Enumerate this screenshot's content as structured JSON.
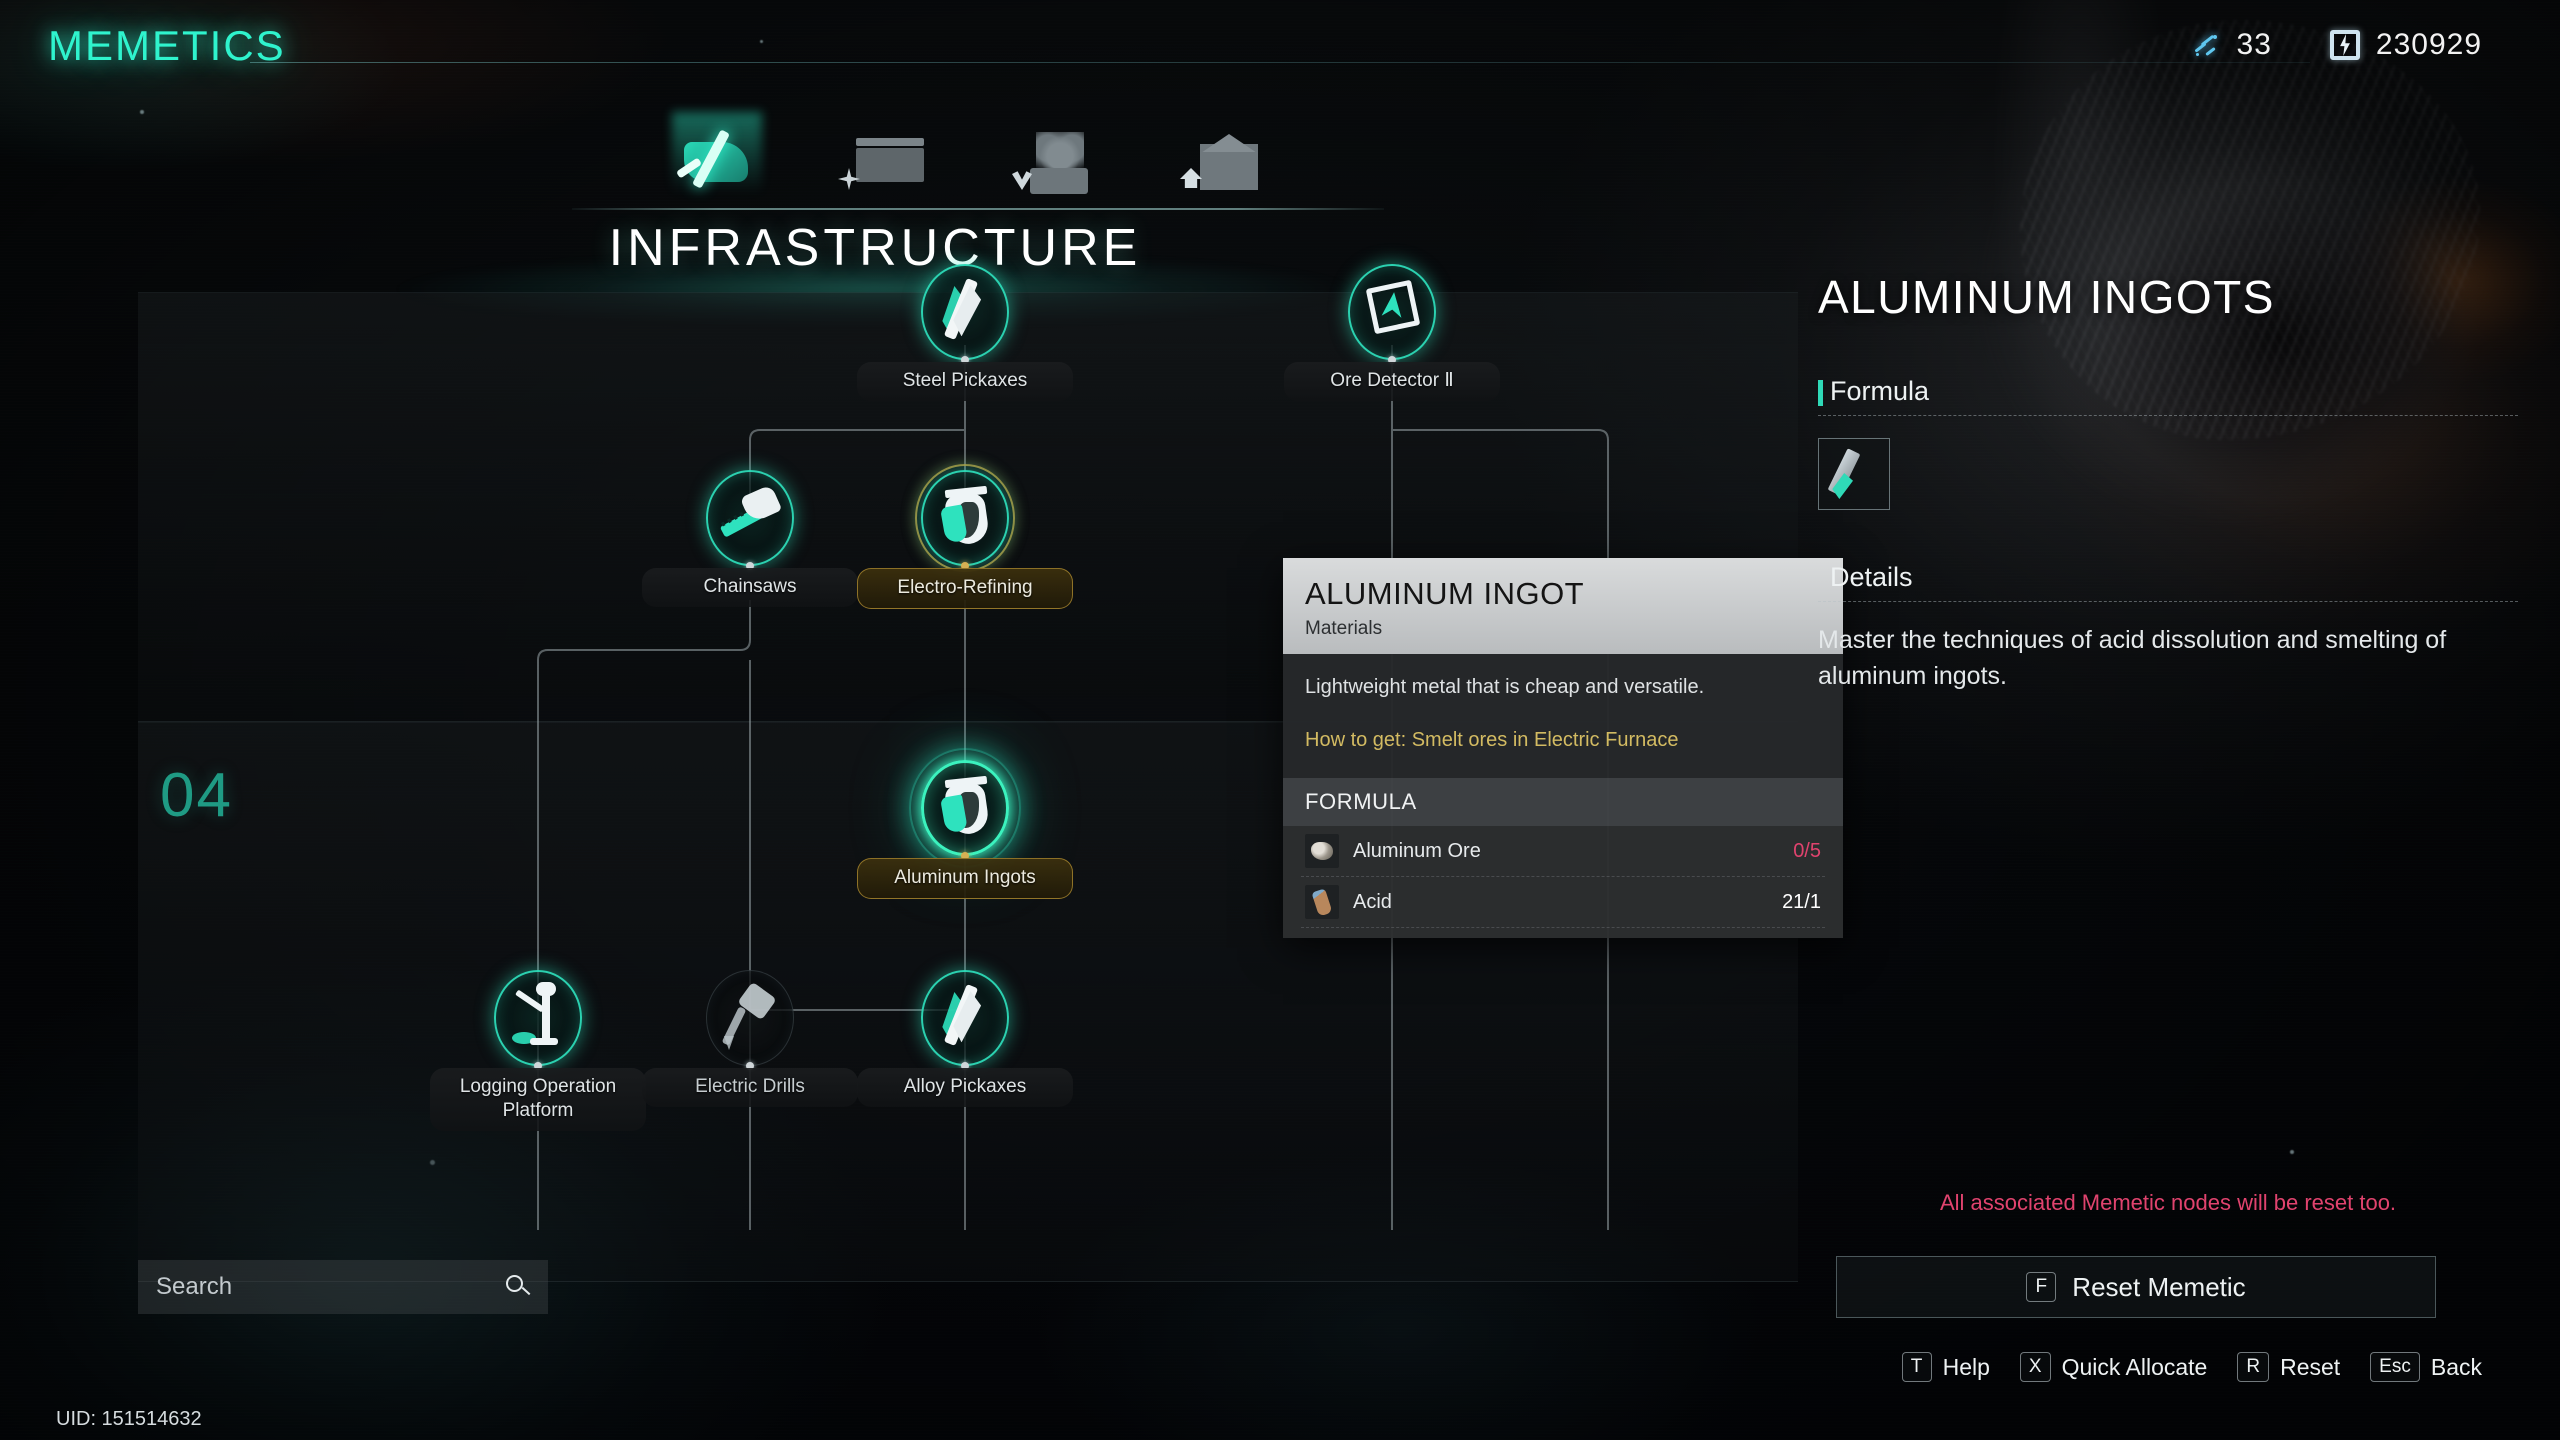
{
  "header": {
    "title": "MEMETICS",
    "currencies": [
      {
        "icon": "memetic-shard-icon",
        "value": "33"
      },
      {
        "icon": "energy-chip-icon",
        "value": "230929"
      }
    ]
  },
  "tabs": [
    {
      "id": "infrastructure",
      "icon": "pickaxe-rock-icon",
      "selected": true
    },
    {
      "id": "workbench",
      "icon": "workbench-icon",
      "selected": false
    },
    {
      "id": "agriculture",
      "icon": "planter-bush-icon",
      "selected": false
    },
    {
      "id": "housing",
      "icon": "house-icon",
      "selected": false
    }
  ],
  "tree": {
    "title": "INFRASTRUCTURE",
    "tier_label": "04",
    "nodes": [
      {
        "id": "steel-pickaxes",
        "label": "Steel Pickaxes",
        "state": "unlocked"
      },
      {
        "id": "ore-detector-ii",
        "label": "Ore Detector Ⅱ",
        "state": "unlocked"
      },
      {
        "id": "chainsaws",
        "label": "Chainsaws",
        "state": "unlocked"
      },
      {
        "id": "electro-refining",
        "label": "Electro-Refining",
        "state": "allocated"
      },
      {
        "id": "aluminum-ingots",
        "label": "Aluminum Ingots",
        "state": "selected"
      },
      {
        "id": "logging-platform",
        "label": "Logging Operation Platform",
        "state": "unlocked"
      },
      {
        "id": "electric-drills",
        "label": "Electric Drills",
        "state": "locked"
      },
      {
        "id": "alloy-pickaxes",
        "label": "Alloy Pickaxes",
        "state": "unlocked"
      }
    ]
  },
  "tooltip": {
    "title": "ALUMINUM INGOT",
    "category": "Materials",
    "description": "Lightweight metal that is cheap and versatile.",
    "how_to_get": "How to get: Smelt ores in Electric Furnace",
    "formula_header": "FORMULA",
    "ingredients": [
      {
        "icon": "aluminum-ore-icon",
        "name": "Aluminum Ore",
        "qty": "0/5",
        "lacking": true
      },
      {
        "icon": "acid-bottle-icon",
        "name": "Acid",
        "qty": "21/1",
        "lacking": false
      }
    ]
  },
  "detail": {
    "title": "ALUMINUM INGOTS",
    "formula_label": "Formula",
    "formula_item_icon": "aluminum-ingot-icon",
    "details_label": "Details",
    "details_text": "Master the techniques of acid dissolution and smelting of aluminum ingots.",
    "warning": "All associated Memetic nodes will be reset too.",
    "reset_key": "F",
    "reset_label": "Reset Memetic"
  },
  "search": {
    "placeholder": "Search",
    "value": "",
    "icon": "search-icon"
  },
  "footer": {
    "uid": "UID: 151514632",
    "hotkeys": [
      {
        "key": "T",
        "label": "Help"
      },
      {
        "key": "X",
        "label": "Quick Allocate"
      },
      {
        "key": "R",
        "label": "Reset"
      },
      {
        "key": "Esc",
        "label": "Back"
      }
    ]
  },
  "colors": {
    "accent": "#2ff3cd",
    "gold": "#ba9638",
    "danger": "#e0436e",
    "tier": "#1f9b84"
  }
}
